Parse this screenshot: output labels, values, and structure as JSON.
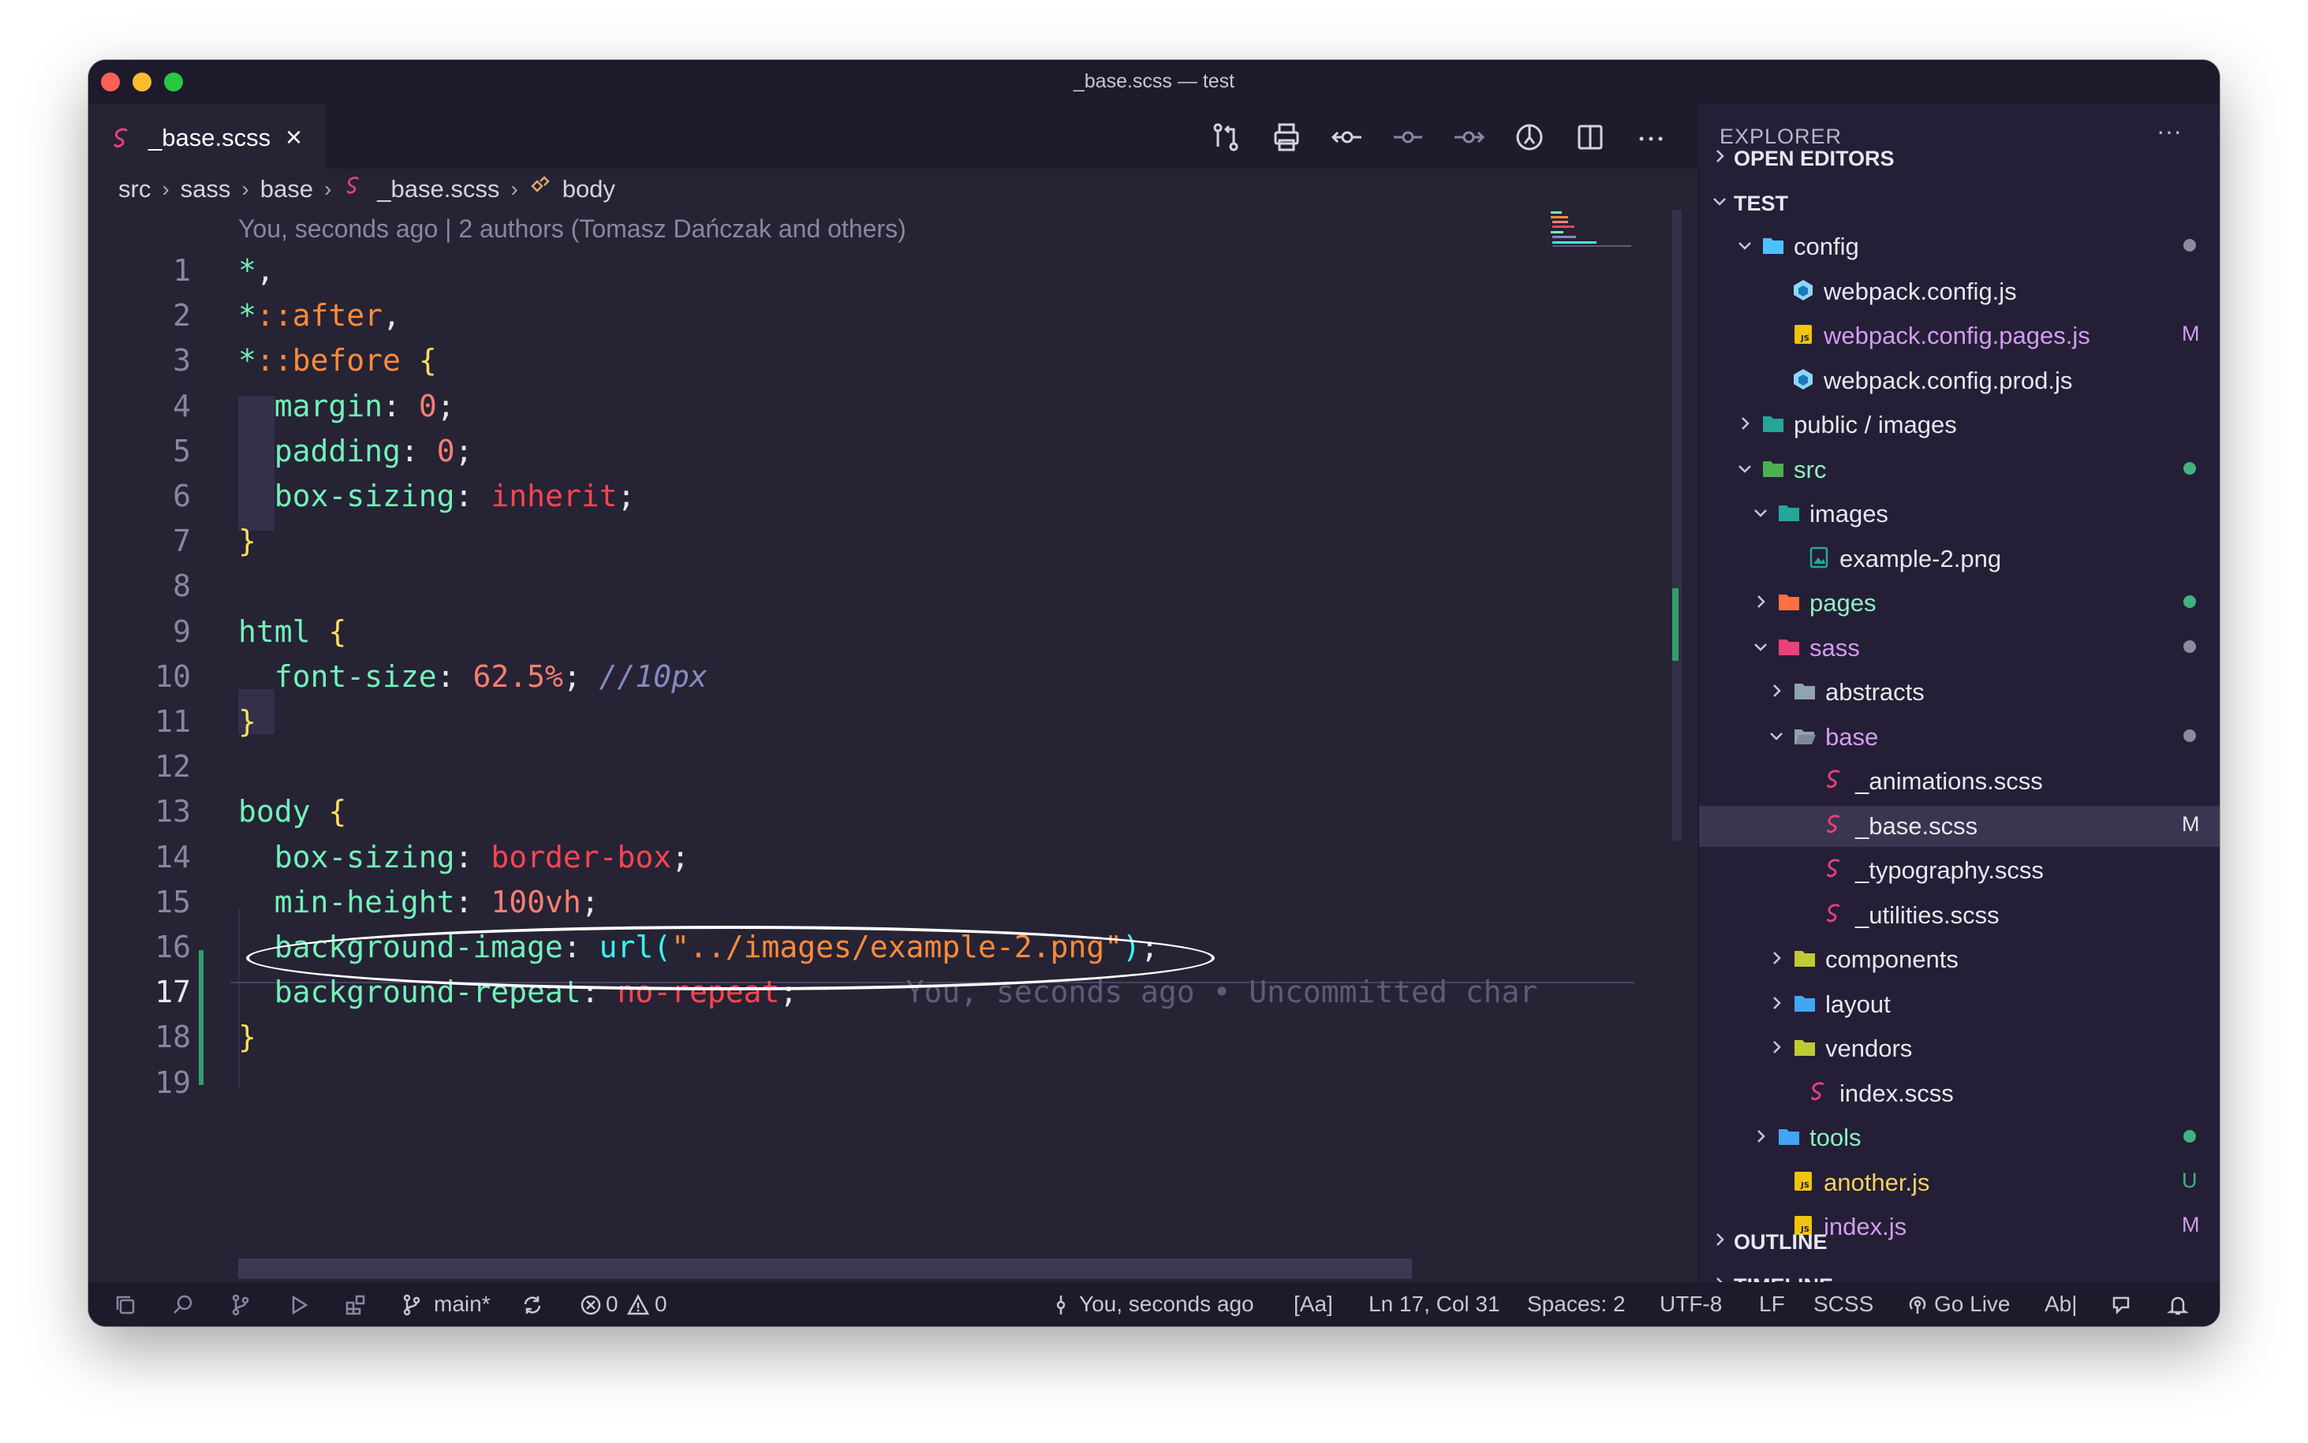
{
  "window": {
    "title": "_base.scss — test"
  },
  "tab": {
    "filename": "_base.scss"
  },
  "breadcrumb": {
    "parts": [
      "src",
      "sass",
      "base",
      "_base.scss",
      "body"
    ]
  },
  "blame_header": "You, seconds ago | 2 authors (Tomasz Dańczak and others)",
  "editor": {
    "lines": [
      {
        "n": "1",
        "tokens": [
          [
            "sel",
            "*"
          ],
          [
            "punc",
            ","
          ]
        ]
      },
      {
        "n": "2",
        "tokens": [
          [
            "sel",
            "*"
          ],
          [
            "pse",
            "::after"
          ],
          [
            "punc",
            ","
          ]
        ]
      },
      {
        "n": "3",
        "tokens": [
          [
            "sel",
            "*"
          ],
          [
            "pse",
            "::before"
          ],
          [
            "punc",
            " "
          ],
          [
            "brace",
            "{"
          ]
        ]
      },
      {
        "n": "4",
        "tokens": [
          [
            "punc",
            "  "
          ],
          [
            "prop",
            "margin"
          ],
          [
            "punc",
            ": "
          ],
          [
            "val",
            "0"
          ],
          [
            "punc",
            ";"
          ]
        ]
      },
      {
        "n": "5",
        "tokens": [
          [
            "punc",
            "  "
          ],
          [
            "prop",
            "padding"
          ],
          [
            "punc",
            ": "
          ],
          [
            "val",
            "0"
          ],
          [
            "punc",
            ";"
          ]
        ]
      },
      {
        "n": "6",
        "tokens": [
          [
            "punc",
            "  "
          ],
          [
            "prop",
            "box-sizing"
          ],
          [
            "punc",
            ": "
          ],
          [
            "kw",
            "inherit"
          ],
          [
            "punc",
            ";"
          ]
        ]
      },
      {
        "n": "7",
        "tokens": [
          [
            "brace",
            "}"
          ]
        ]
      },
      {
        "n": "8",
        "tokens": []
      },
      {
        "n": "9",
        "tokens": [
          [
            "sel",
            "html"
          ],
          [
            "punc",
            " "
          ],
          [
            "brace",
            "{"
          ]
        ]
      },
      {
        "n": "10",
        "tokens": [
          [
            "punc",
            "  "
          ],
          [
            "prop",
            "font-size"
          ],
          [
            "punc",
            ": "
          ],
          [
            "val",
            "62.5%"
          ],
          [
            "punc",
            "; "
          ],
          [
            "cmt",
            "//10px"
          ]
        ]
      },
      {
        "n": "11",
        "tokens": [
          [
            "brace",
            "}"
          ]
        ]
      },
      {
        "n": "12",
        "tokens": []
      },
      {
        "n": "13",
        "tokens": [
          [
            "sel",
            "body"
          ],
          [
            "punc",
            " "
          ],
          [
            "brace",
            "{"
          ]
        ]
      },
      {
        "n": "14",
        "tokens": [
          [
            "punc",
            "  "
          ],
          [
            "prop",
            "box-sizing"
          ],
          [
            "punc",
            ": "
          ],
          [
            "kw",
            "border-box"
          ],
          [
            "punc",
            ";"
          ]
        ]
      },
      {
        "n": "15",
        "tokens": [
          [
            "punc",
            "  "
          ],
          [
            "prop",
            "min-height"
          ],
          [
            "punc",
            ": "
          ],
          [
            "val",
            "100vh"
          ],
          [
            "punc",
            ";"
          ]
        ]
      },
      {
        "n": "16",
        "tokens": [
          [
            "punc",
            "  "
          ],
          [
            "prop",
            "background-image"
          ],
          [
            "punc",
            ": "
          ],
          [
            "fn",
            "url("
          ],
          [
            "str",
            "\"../images/example-2.png\""
          ],
          [
            "fn",
            ")"
          ],
          [
            "punc",
            ";"
          ]
        ]
      },
      {
        "n": "17",
        "tokens": [
          [
            "punc",
            "  "
          ],
          [
            "prop",
            "background-repeat"
          ],
          [
            "punc",
            ": "
          ],
          [
            "kw",
            "no-repeat"
          ],
          [
            "punc",
            ";"
          ],
          [
            "ghost",
            "      You, seconds ago • Uncommitted char"
          ]
        ]
      },
      {
        "n": "18",
        "tokens": [
          [
            "brace",
            "}"
          ]
        ]
      },
      {
        "n": "19",
        "tokens": []
      }
    ]
  },
  "explorer": {
    "title": "EXPLORER",
    "more": "···",
    "rows": [
      {
        "label": "OPEN EDITORS",
        "depth": 0,
        "chev": "right",
        "header": true
      },
      {
        "label": "TEST",
        "depth": 0,
        "chev": "down",
        "header": true
      },
      {
        "label": "config",
        "depth": 1,
        "chev": "down",
        "icon": "folder-config-icon",
        "color": "#4fc1ff",
        "dot": "#8c8a9b"
      },
      {
        "label": "webpack.config.js",
        "depth": 2,
        "icon": "webpack-icon",
        "color": "#8ed6fb"
      },
      {
        "label": "webpack.config.pages.js",
        "depth": 2,
        "icon": "js-file-icon",
        "color": "#f1c40f",
        "status": "mod",
        "badge": "M",
        "badgeColor": "#d49cf0"
      },
      {
        "label": "webpack.config.prod.js",
        "depth": 2,
        "icon": "webpack-icon",
        "color": "#8ed6fb"
      },
      {
        "label": "public / images",
        "depth": 1,
        "chev": "right",
        "icon": "folder-images-icon",
        "color": "#26a69a"
      },
      {
        "label": "src",
        "depth": 1,
        "chev": "down",
        "icon": "folder-src-icon",
        "color": "#4caf50",
        "status": "green",
        "dot": "#3fb27f"
      },
      {
        "label": "images",
        "depth": 2,
        "chev": "down",
        "icon": "folder-images-icon",
        "color": "#26a69a"
      },
      {
        "label": "example-2.png",
        "depth": 3,
        "icon": "image-file-icon",
        "color": "#26a69a"
      },
      {
        "label": "pages",
        "depth": 2,
        "chev": "right",
        "icon": "folder-pages-icon",
        "color": "#ff7043",
        "status": "green",
        "dot": "#3fb27f"
      },
      {
        "label": "sass",
        "depth": 2,
        "chev": "down",
        "icon": "folder-sass-icon",
        "color": "#ec407a",
        "status": "mod",
        "dot": "#8c8a9b"
      },
      {
        "label": "abstracts",
        "depth": 3,
        "chev": "right",
        "icon": "folder-icon",
        "color": "#90a4ae"
      },
      {
        "label": "base",
        "depth": 3,
        "chev": "down",
        "icon": "folder-open-icon",
        "color": "#90a4ae",
        "status": "mod",
        "dot": "#8c8a9b"
      },
      {
        "label": "_animations.scss",
        "depth": 4,
        "icon": "sass-file-icon",
        "color": "#ec407a"
      },
      {
        "label": "_base.scss",
        "depth": 4,
        "icon": "sass-file-icon",
        "color": "#ec407a",
        "active": true,
        "badge": "M",
        "badgeColor": "#e8e6ef"
      },
      {
        "label": "_typography.scss",
        "depth": 4,
        "icon": "sass-file-icon",
        "color": "#ec407a"
      },
      {
        "label": "_utilities.scss",
        "depth": 4,
        "icon": "sass-file-icon",
        "color": "#ec407a"
      },
      {
        "label": "components",
        "depth": 3,
        "chev": "right",
        "icon": "folder-components-icon",
        "color": "#c0ca33"
      },
      {
        "label": "layout",
        "depth": 3,
        "chev": "right",
        "icon": "folder-layout-icon",
        "color": "#42a5f5"
      },
      {
        "label": "vendors",
        "depth": 3,
        "chev": "right",
        "icon": "folder-vendors-icon",
        "color": "#c0ca33"
      },
      {
        "label": "index.scss",
        "depth": 3,
        "icon": "sass-file-icon",
        "color": "#ec407a"
      },
      {
        "label": "tools",
        "depth": 2,
        "chev": "right",
        "icon": "folder-tools-icon",
        "color": "#42a5f5",
        "status": "green",
        "dot": "#3fb27f"
      },
      {
        "label": "another.js",
        "depth": 2,
        "icon": "js-file-icon",
        "color": "#f1c40f",
        "status": "new",
        "badge": "U",
        "badgeColor": "#3fb27f"
      },
      {
        "label": "index.js",
        "depth": 2,
        "icon": "js-file-icon",
        "color": "#f1c40f",
        "status": "mod",
        "badge": "M",
        "badgeColor": "#d49cf0"
      }
    ],
    "bottom": [
      {
        "label": "OUTLINE"
      },
      {
        "label": "TIMELINE"
      }
    ]
  },
  "statusbar": {
    "branch": "main*",
    "errors": "0",
    "warnings": "0",
    "blame": "You, seconds ago",
    "aa": "[Aa]",
    "position": "Ln 17, Col 31",
    "spaces": "Spaces: 2",
    "encoding": "UTF-8",
    "eol": "LF",
    "language": "SCSS",
    "golive": "Go Live",
    "abl": "Ab|"
  },
  "colors": {
    "background": "#262335",
    "accent": "#72f1b8",
    "string": "#ff8b39",
    "keyword": "#fe4450"
  }
}
